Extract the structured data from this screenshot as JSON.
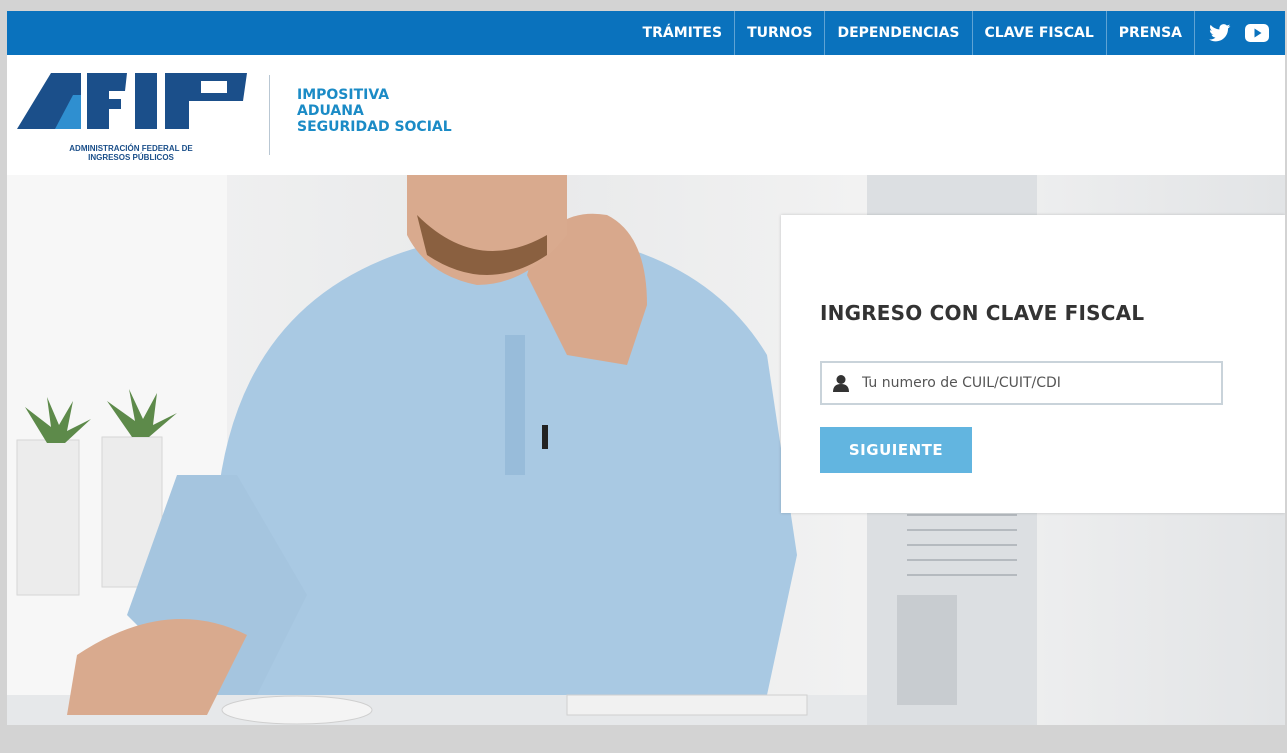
{
  "nav": {
    "items": [
      "TRÁMITES",
      "TURNOS",
      "DEPENDENCIAS",
      "CLAVE FISCAL",
      "PRENSA"
    ],
    "social": [
      "twitter-icon",
      "youtube-icon"
    ]
  },
  "header": {
    "logo_caption_line1": "ADMINISTRACIÓN FEDERAL DE",
    "logo_caption_line2": "INGRESOS PÚBLICOS",
    "tagline": [
      "IMPOSITIVA",
      "ADUANA",
      "SEGURIDAD SOCIAL"
    ]
  },
  "login": {
    "title": "INGRESO CON CLAVE FISCAL",
    "cuil_placeholder": "Tu numero de CUIL/CUIT/CDI",
    "cuil_value": "",
    "next_label": "SIGUIENTE"
  },
  "colors": {
    "topbar": "#0a72bd",
    "tagline": "#1b8bc6",
    "button": "#62b5e0",
    "logo": "#1b4f8a"
  }
}
